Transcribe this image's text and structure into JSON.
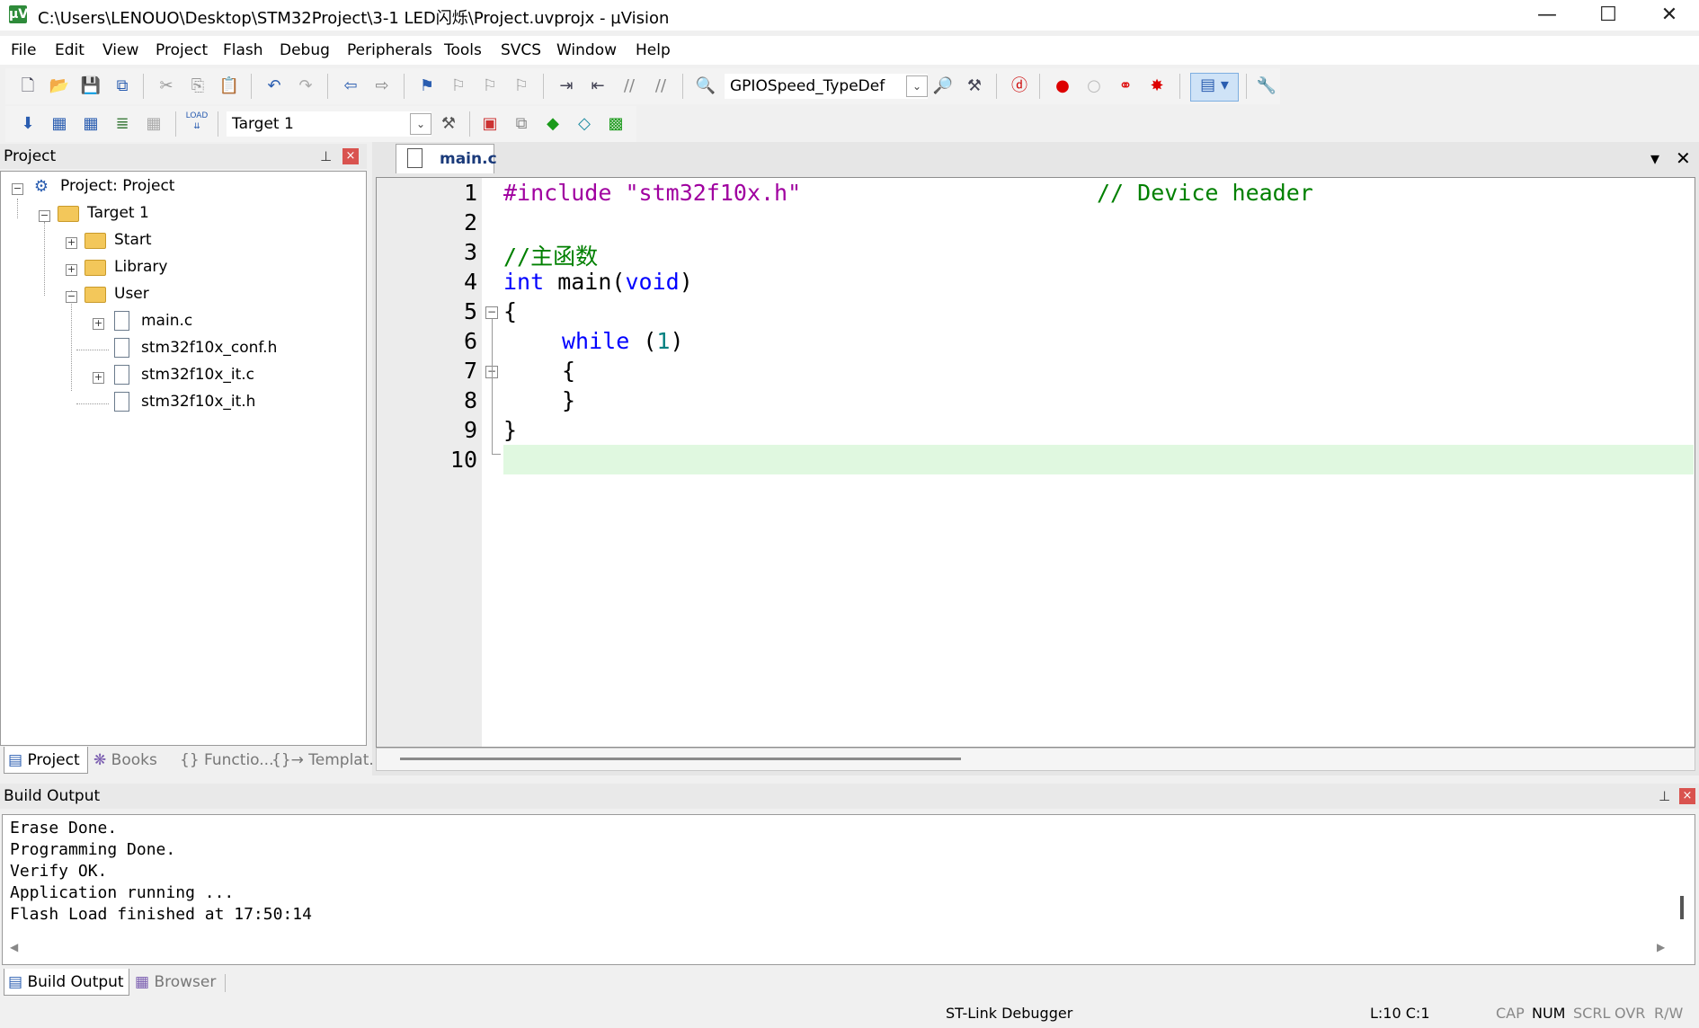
{
  "window": {
    "title": "C:\\Users\\LENOUO\\Desktop\\STM32Project\\3-1 LED闪烁\\Project.uvprojx - µVision",
    "app_icon": "µV",
    "minimize": "—",
    "maximize": "☐",
    "close": "✕"
  },
  "menu": [
    "File",
    "Edit",
    "View",
    "Project",
    "Flash",
    "Debug",
    "Peripherals",
    "Tools",
    "SVCS",
    "Window",
    "Help"
  ],
  "toolbar1": {
    "find_combo": "GPIOSpeed_TypeDef"
  },
  "toolbar2": {
    "target_combo": "Target 1",
    "load_label": "LOAD"
  },
  "project_panel": {
    "title": "Project",
    "pin": "⊥",
    "close": "×",
    "tree": {
      "root": "Project: Project",
      "target": "Target 1",
      "groups": [
        "Start",
        "Library",
        "User"
      ],
      "files": [
        "main.c",
        "stm32f10x_conf.h",
        "stm32f10x_it.c",
        "stm32f10x_it.h"
      ]
    },
    "tabs": [
      "Project",
      "Books",
      "{} Functio...",
      "{}→ Templat..."
    ]
  },
  "editor": {
    "tab": "main.c",
    "tab_menu": "▾",
    "tab_close": "✕",
    "line_numbers": [
      "1",
      "2",
      "3",
      "4",
      "5",
      "6",
      "7",
      "8",
      "9",
      "10"
    ],
    "code": {
      "l1_directive": "#include",
      "l1_string": "\"stm32f10x.h\"",
      "l1_comment": "// Device header",
      "l3_comment": "//主函数",
      "l4_type": "int",
      "l4_name": " main(",
      "l4_param": "void",
      "l4_close": ")",
      "l5": "{",
      "l6_kw": "while",
      "l6_open": " (",
      "l6_num": "1",
      "l6_close": ")",
      "l7": "{",
      "l8": "}",
      "l9": "}"
    },
    "current_line": 10
  },
  "build_output": {
    "title": "Build Output",
    "lines": [
      "Erase Done.",
      "Programming Done.",
      "Verify OK.",
      "Application running ...",
      "Flash Load finished at 17:50:14"
    ],
    "tabs": [
      "Build Output",
      "Browser"
    ]
  },
  "status": {
    "debugger": "ST-Link Debugger",
    "position": "L:10 C:1",
    "cap": "CAP",
    "num": "NUM",
    "scrl": "SCRL",
    "ovr": "OVR",
    "rw": "R/W"
  },
  "colors": {
    "keyword": "#0000ff",
    "directive": "#a000a0",
    "string": "#a000a0",
    "comment": "#008000",
    "number": "#008080",
    "current_line_bg": "#e0f8e0"
  }
}
